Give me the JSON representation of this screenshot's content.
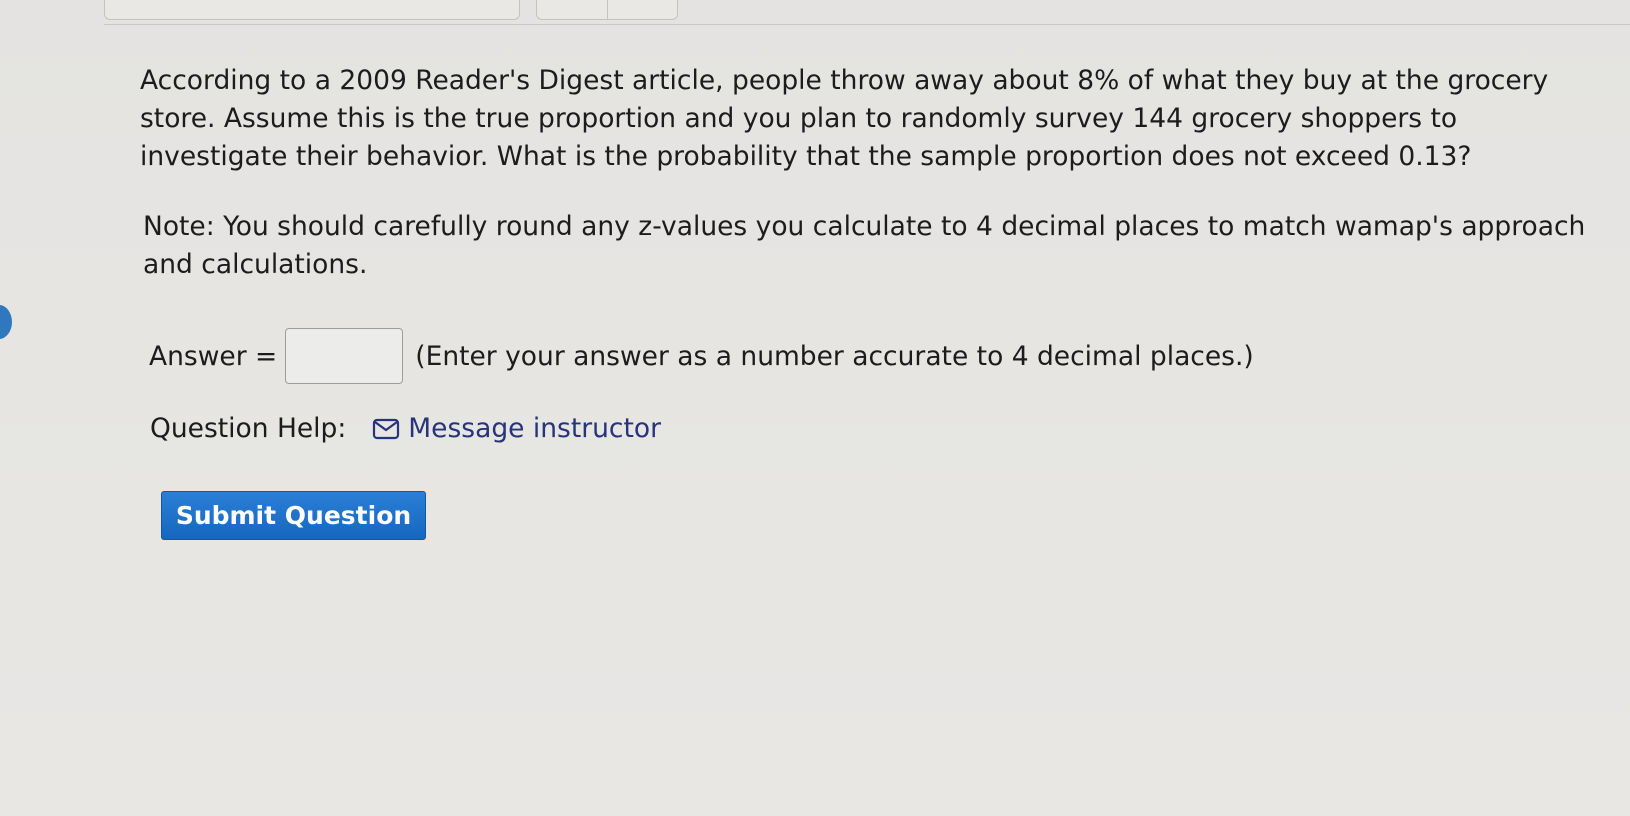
{
  "question": {
    "text": "According to a 2009 Reader's Digest article, people throw away about 8% of what they buy at the grocery store. Assume this is the true proportion and you plan to randomly survey 144 grocery shoppers to investigate their behavior. What is the probability that the sample proportion does not exceed 0.13?",
    "note": "Note: You should carefully round any z-values you calculate to 4 decimal places to match wamap's approach and calculations."
  },
  "answer": {
    "label": "Answer =",
    "value": "",
    "instruction": "(Enter your answer as a number accurate to 4 decimal places.)"
  },
  "help": {
    "label": "Question Help:",
    "link_label": "Message instructor",
    "icon": "mail-icon"
  },
  "submit": {
    "label": "Submit Question"
  },
  "colors": {
    "button": "#1a6fc9",
    "link": "#27337a",
    "background": "#e6e5e2"
  }
}
